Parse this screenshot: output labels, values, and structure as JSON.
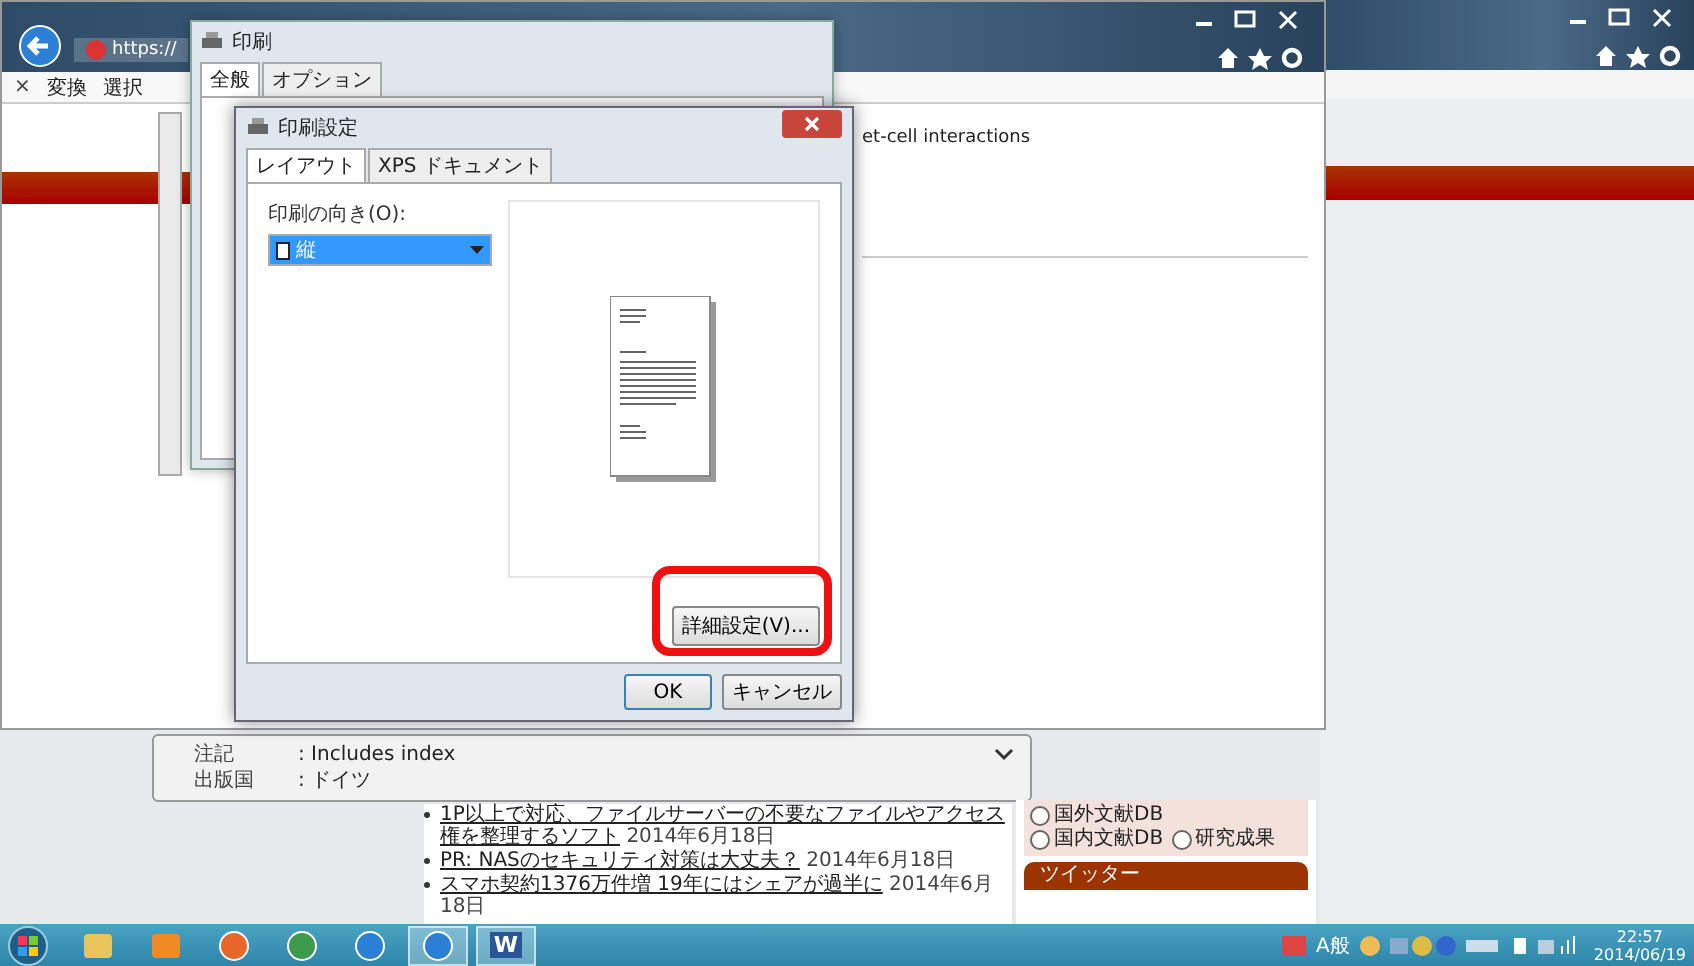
{
  "browser": {
    "tab_title": "https://",
    "toolbar_close": "×",
    "toolbar_items": [
      "変換",
      "選択"
    ],
    "content_text": "et-cell interactions"
  },
  "record": [
    {
      "label": "注記",
      "value": ": Includes index"
    },
    {
      "label": "出版国",
      "value": ": ドイツ"
    }
  ],
  "news_links": [
    {
      "title": "1P以上で対応、ファイルサーバーの不要なファイルやアクセス権を整理するソフト",
      "date": "2014年6月18日"
    },
    {
      "title": "PR: NASのセキュリティ対策は大丈夫？",
      "date": "2014年6月18日"
    },
    {
      "title": "スマホ契約1376万件増 19年にはシェアが過半に",
      "date": "2014年6月18日"
    }
  ],
  "sidebar": {
    "databases": [
      {
        "label": "国外文献DB",
        "checked": false
      },
      {
        "label": "国内文献DB",
        "checked": false
      },
      {
        "label": "研究成果",
        "checked": false
      }
    ],
    "twitter_heading": "ツイッター"
  },
  "print_dialog": {
    "title": "印刷",
    "tabs": [
      {
        "label": "全般",
        "selected": true
      },
      {
        "label": "オプション",
        "selected": false
      }
    ]
  },
  "print_settings": {
    "title": "印刷設定",
    "tabs": [
      {
        "label": "レイアウト",
        "selected": true
      },
      {
        "label": "XPS ドキュメント",
        "selected": false
      }
    ],
    "orientation_label": "印刷の向き(O):",
    "orientation_value": "縦",
    "advanced_button": "詳細設定(V)...",
    "advanced_highlighted": true,
    "buttons": [
      "OK",
      "キャンセル"
    ]
  },
  "taskbar": {
    "apps": [
      {
        "kind": "folder",
        "active": false
      },
      {
        "kind": "media",
        "active": false
      },
      {
        "kind": "firefox",
        "active": false
      },
      {
        "kind": "chrome",
        "active": false
      },
      {
        "kind": "ie",
        "active": false
      },
      {
        "kind": "ie",
        "active": true
      },
      {
        "kind": "word",
        "glyph": "W",
        "active": true
      }
    ],
    "ime": "A般",
    "time": "22:57",
    "date": "2014/06/19"
  }
}
